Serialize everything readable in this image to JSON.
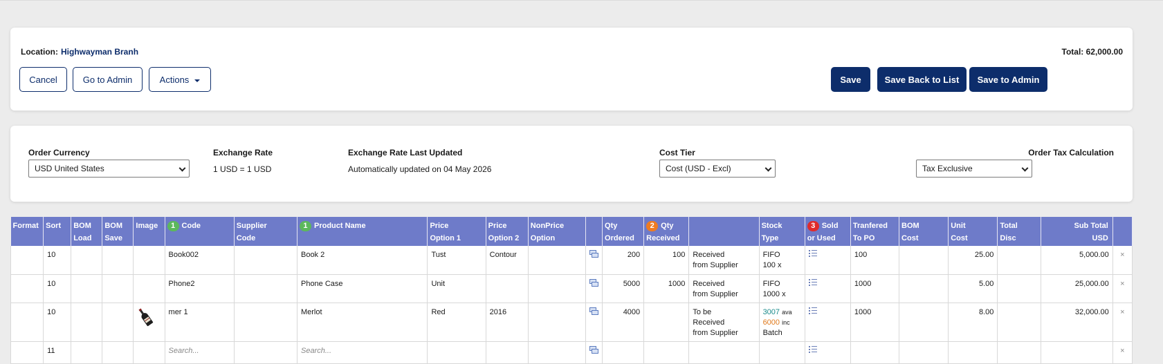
{
  "header": {
    "location_label": "Location:",
    "location_value": "Highwayman Branh",
    "total": "Total: 62,000.00",
    "buttons": {
      "cancel": "Cancel",
      "go_to_admin": "Go to Admin",
      "actions": "Actions",
      "save": "Save",
      "save_back_to_list": "Save Back to List",
      "save_to_admin": "Save to Admin"
    }
  },
  "settings": {
    "order_currency_label": "Order Currency",
    "order_currency_value": "USD United States",
    "exchange_rate_label": "Exchange Rate",
    "exchange_rate_value": "1 USD = 1 USD",
    "exchange_updated_label": "Exchange Rate Last Updated",
    "exchange_updated_value": "Automatically updated on 04 May 2026",
    "cost_tier_label": "Cost Tier",
    "cost_tier_value": "Cost (USD - Excl)",
    "tax_calc_label": "Order Tax Calculation",
    "tax_calc_value": "Tax Exclusive"
  },
  "table": {
    "headers": {
      "format": "Format",
      "sort": "Sort",
      "bom_load_1": "BOM",
      "bom_load_2": "Load",
      "bom_save_1": "BOM",
      "bom_save_2": "Save",
      "image": "Image",
      "code_badge": "1",
      "code": "Code",
      "supplier_code_1": "Supplier",
      "supplier_code_2": "Code",
      "product_badge": "1",
      "product": "Product Name",
      "price1_1": "Price",
      "price1_2": "Option 1",
      "price2_1": "Price",
      "price2_2": "Option 2",
      "nonprice_1": "NonPrice",
      "nonprice_2": "Option",
      "qty_ordered_1": "Qty",
      "qty_ordered_2": "Ordered",
      "qty_received_badge": "2",
      "qty_received_1": "Qty",
      "qty_received_2": "Received",
      "stock_type_1": "Stock",
      "stock_type_2": "Type",
      "sold_badge": "3",
      "sold_1": "Sold",
      "sold_2": "or Used",
      "transfered_1": "Tranfered",
      "transfered_2": "To PO",
      "bom_cost_1": "BOM",
      "bom_cost_2": "Cost",
      "unit_cost_1": "Unit",
      "unit_cost_2": "Cost",
      "total_disc_1": "Total",
      "total_disc_2": "Disc",
      "subtotal_1": "Sub Total",
      "subtotal_2": "USD"
    },
    "rows": [
      {
        "sort": "10",
        "code": "Book002",
        "product": "Book 2",
        "price1": "Tust",
        "price2": "Contour",
        "qty_ordered": "200",
        "qty_received": "100",
        "status_1": "Received",
        "status_2": "from Supplier",
        "stock_1": "FIFO",
        "stock_2": "100 x",
        "transfered": "100",
        "unit_cost": "25.00",
        "subtotal": "5,000.00"
      },
      {
        "sort": "10",
        "code": "Phone2",
        "product": "Phone Case",
        "price1": "Unit",
        "price2": "",
        "qty_ordered": "5000",
        "qty_received": "1000",
        "status_1": "Received",
        "status_2": "from Supplier",
        "stock_1": "FIFO",
        "stock_2": "1000 x",
        "transfered": "1000",
        "unit_cost": "5.00",
        "subtotal": "25,000.00"
      },
      {
        "sort": "10",
        "code": "mer 1",
        "product": "Merlot",
        "price1": "Red",
        "price2": "2016",
        "qty_ordered": "4000",
        "qty_received": "",
        "status_1": "To be",
        "status_2": "Received",
        "status_3": "from Supplier",
        "stock_avail_num": "3007",
        "stock_avail_txt": "ava",
        "stock_inc_num": "6000",
        "stock_inc_txt": "inc",
        "stock_3": "Batch",
        "transfered": "1000",
        "unit_cost": "8.00",
        "subtotal": "32,000.00",
        "image_icon": "wine-bottle-icon"
      },
      {
        "sort": "11",
        "code_placeholder": "Search...",
        "product_placeholder": "Search..."
      }
    ],
    "remove_symbol": "×"
  },
  "colors": {
    "primary": "#0d2d6b",
    "table_header": "#6e7bc9",
    "badge_green": "#5cb85c",
    "badge_orange": "#ee7b21",
    "badge_red": "#e02b2b",
    "available": "#1c8c8c",
    "incoming": "#e07a1c"
  }
}
